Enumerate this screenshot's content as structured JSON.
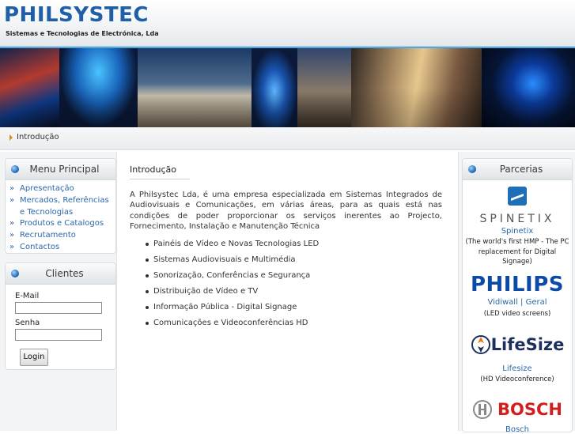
{
  "header": {
    "company": "PHILSYSTEC",
    "tagline": "Sistemas e Tecnologias de Electrónica, Lda"
  },
  "breadcrumb": {
    "current": "Introdução"
  },
  "menu_principal": {
    "title": "Menu Principal",
    "items": [
      "Apresentação",
      "Mercados, Referências e Tecnologias",
      "Produtos e Catalogos",
      "Recrutamento",
      "Contactos"
    ]
  },
  "clientes": {
    "title": "Clientes",
    "email_label": "E-Mail",
    "password_label": "Senha",
    "login_label": "Login"
  },
  "main": {
    "title": "Introdução",
    "intro": "A Philsystec Lda, é uma empresa especializada em Sistemas Integrados de Audiovisuais e Comunicações, em várias áreas, para as quais está nas condições de poder proporcionar os serviços inerentes ao Projecto, Fornecimento, Instalação e Manutenção Técnica",
    "features": [
      "Painéis de Vídeo e Novas Tecnologias LED",
      "Sistemas Audiovisuais e Multimédia",
      "Sonorização, Conferências e Segurança",
      "Distribuição de Vídeo e TV",
      "Informação Pública - Digital Signage",
      "Comunicações e Videoconferências HD"
    ]
  },
  "parcerias": {
    "title": "Parcerias",
    "partners": [
      {
        "logo": "SPINETIX",
        "name": "Spinetix",
        "desc": "(The world's first HMP - The PC replacement for Digital Signage)"
      },
      {
        "logo": "PHILIPS",
        "name": "Vidiwall | Geral",
        "desc": "(LED video screens)"
      },
      {
        "logo": "LifeSize",
        "name": "Lifesize",
        "desc": "(HD Videoconference)"
      },
      {
        "logo": "BOSCH",
        "name": "Bosch",
        "desc": ""
      }
    ]
  },
  "colors": {
    "brand_blue": "#1f5fa8",
    "link_blue": "#2a68a8",
    "accent_orange": "#e08a1e"
  },
  "icons": [
    "bullet-sphere-icon",
    "breadcrumb-arrow-icon",
    "spinetix-icon",
    "lifesize-icon",
    "bosch-icon"
  ]
}
